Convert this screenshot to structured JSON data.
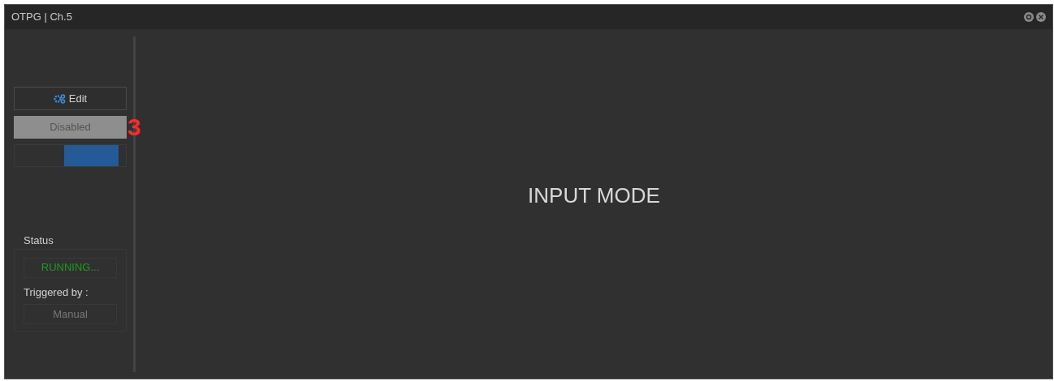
{
  "window": {
    "title": "OTPG | Ch.5"
  },
  "sidebar": {
    "edit_button": "Edit",
    "enable_button": {
      "label": "Disabled",
      "disabled": true
    },
    "annotation": "3",
    "toggle": {
      "on": true
    },
    "status": {
      "label": "Status",
      "value": "RUNNING...",
      "triggered_label": "Triggered by :",
      "triggered_value": "Manual"
    }
  },
  "main": {
    "mode": "INPUT MODE"
  }
}
